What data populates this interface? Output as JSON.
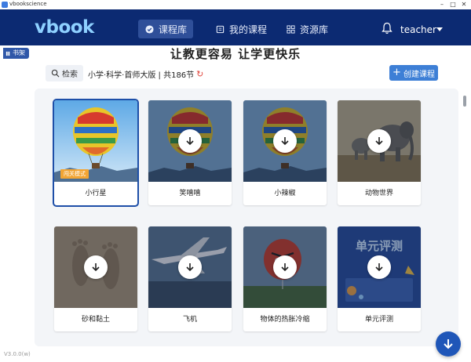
{
  "window": {
    "title": "vbookscience"
  },
  "header": {
    "logo": "vbook",
    "nav": [
      {
        "label": "课程库",
        "icon": "shield-check-icon",
        "active": true
      },
      {
        "label": "我的课程",
        "icon": "book-icon",
        "active": false
      },
      {
        "label": "资源库",
        "icon": "grid-icon",
        "active": false
      }
    ],
    "user": "teacher"
  },
  "shelf_tab": "书架",
  "slogan": "让教更容易 让学更快乐",
  "toolbar": {
    "search_label": "检索",
    "meta": "小学·科学·首师大版 | 共186节",
    "create_label": "创建课程"
  },
  "courses": [
    {
      "title": "小行星",
      "thumb": "balloon",
      "badge": "闯关模式",
      "downloaded": true,
      "selected": true
    },
    {
      "title": "笑嘻嘻",
      "thumb": "balloon",
      "downloaded": false
    },
    {
      "title": "小辣椒",
      "thumb": "balloon",
      "downloaded": false
    },
    {
      "title": "动物世界",
      "thumb": "elephant",
      "downloaded": false
    },
    {
      "title": "砂和黏土",
      "thumb": "footprints",
      "downloaded": false
    },
    {
      "title": "飞机",
      "thumb": "airplane",
      "downloaded": false
    },
    {
      "title": "物体的热胀冷缩",
      "thumb": "redbird",
      "downloaded": false
    },
    {
      "title": "单元评测",
      "thumb": "unit-test",
      "thumb_text": "单元评测",
      "downloaded": false
    }
  ],
  "version": "V3.0.0(w)",
  "colors": {
    "header": "#0c2a72",
    "accent": "#3d7fd6",
    "badge": "#f3a534"
  }
}
